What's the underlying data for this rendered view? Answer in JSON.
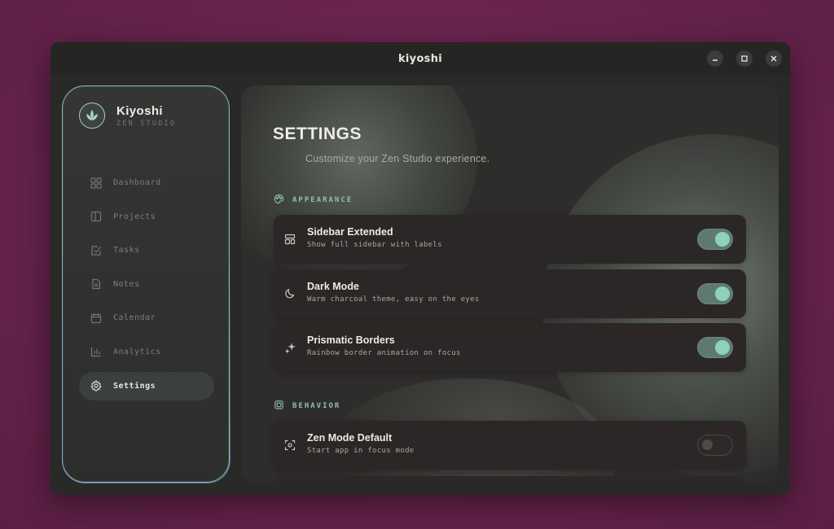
{
  "window": {
    "title": "kiyoshi"
  },
  "window_controls": [
    "minimize",
    "maximize",
    "close"
  ],
  "brand": {
    "name": "Kiyoshi",
    "subtitle": "ZEN STUDIO",
    "logo_icon": "lotus-icon"
  },
  "sidebar": {
    "items": [
      {
        "label": "Dashboard",
        "icon": "grid-icon",
        "active": false
      },
      {
        "label": "Projects",
        "icon": "book-icon",
        "active": false
      },
      {
        "label": "Tasks",
        "icon": "checkbox-icon",
        "active": false
      },
      {
        "label": "Notes",
        "icon": "document-icon",
        "active": false
      },
      {
        "label": "Calendar",
        "icon": "calendar-icon",
        "active": false
      },
      {
        "label": "Analytics",
        "icon": "bar-chart-icon",
        "active": false
      },
      {
        "label": "Settings",
        "icon": "gear-icon",
        "active": true
      }
    ]
  },
  "main": {
    "title": "SETTINGS",
    "subtitle": "Customize your Zen Studio experience.",
    "sections": [
      {
        "title": "APPEARANCE",
        "icon": "palette-icon",
        "settings": [
          {
            "title": "Sidebar Extended",
            "description": "Show full sidebar with labels",
            "icon": "layout-icon",
            "enabled": true
          },
          {
            "title": "Dark Mode",
            "description": "Warm charcoal theme, easy on the eyes",
            "icon": "moon-icon",
            "enabled": true
          },
          {
            "title": "Prismatic Borders",
            "description": "Rainbow border animation on focus",
            "icon": "sparkles-icon",
            "enabled": true
          }
        ]
      },
      {
        "title": "BEHAVIOR",
        "icon": "cpu-icon",
        "settings": [
          {
            "title": "Zen Mode Default",
            "description": "Start app in focus mode",
            "icon": "focus-icon",
            "enabled": false
          }
        ]
      }
    ]
  },
  "colors": {
    "accent": "#8fd1bb",
    "toggle_on": "#5e7a70",
    "desktop": "#6b2650",
    "window": "#2b2b29"
  }
}
